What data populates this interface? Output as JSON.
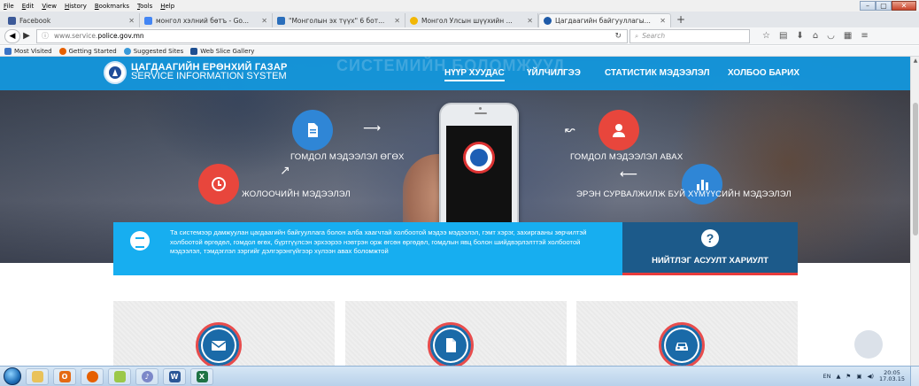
{
  "browser": {
    "menu": [
      "File",
      "Edit",
      "View",
      "History",
      "Bookmarks",
      "Tools",
      "Help"
    ],
    "tabs": [
      {
        "title": "Facebook",
        "color": "#3b5998"
      },
      {
        "title": "монгол хэлний бөтъ - Go...",
        "color": "#4285f4"
      },
      {
        "title": "\"Монголын эх түүх\" 6 бот...",
        "color": "#2a6ebb"
      },
      {
        "title": "Монгол Улсын шүүхийн ...",
        "color": "#f2b705"
      },
      {
        "title": "Цагдаагийн байгууллагы...",
        "color": "#1e5aa8"
      }
    ],
    "url_prefix": "www.service.",
    "url_host": "police.gov.mn",
    "search_placeholder": "Search",
    "bookmarks": [
      "Most Visited",
      "Getting Started",
      "Suggested Sites",
      "Web Slice Gallery"
    ]
  },
  "site": {
    "title": "ЦАГДААГИЙН ЕРӨНХИЙ ГАЗАР",
    "subtitle": "SERVICE INFORMATION SYSTEM",
    "ghost_text": "СИСТЕМИЙН БОЛОМЖУУД",
    "nav": [
      "НҮҮР ХУУДАС",
      "ҮЙЛЧИЛГЭЭ",
      "СТАТИСТИК МЭДЭЭЛЭЛ",
      "ХОЛБОО БАРИХ"
    ]
  },
  "features": [
    {
      "label": "ГОМДОЛ МЭДЭЭЛЭЛ ӨГӨХ",
      "color": "#2f86d6",
      "icon": "document-icon"
    },
    {
      "label": "ГОМДОЛ МЭДЭЭЛЭЛ АВАХ",
      "color": "#e8463c",
      "icon": "user-icon"
    },
    {
      "label": "ЖОЛООЧИЙН МЭДЭЭЛЭЛ",
      "color": "#e8463c",
      "icon": "clock-icon"
    },
    {
      "label": "ЭРЭН СУРВАЛЖИЛЖ БУЙ ХҮМҮҮСИЙН МЭДЭЭЛЭЛ",
      "color": "#2f86d6",
      "icon": "bar-chart-icon"
    }
  ],
  "info": {
    "text": "Та системээр дамжуулан цагдаагийн байгууллага болон алба хаагчтай холбоотой мэдээ мэдээлэл, гэмт хэрэг, захиргааны зөрчилтэй холбоотой өргөдөл, гомдол өгөх, бүртгүүлсэн эрхээрээ нэвтрэн орж өгсөн өргөдөл, гомдлын явц болон шийдвэрлэлттэй холбоотой мэдээлэл, тэмдэглэл зэргийг дэлгэрэнгүйгээр хүлээн авах боломжтой",
    "faq_label": "НИЙТЛЭГ АСУУЛТ ХАРИУЛТ"
  },
  "cards": [
    {
      "icon": "envelope-icon"
    },
    {
      "icon": "file-icon"
    },
    {
      "icon": "car-icon"
    }
  ],
  "taskbar": {
    "lang": "EN",
    "time": "20:05",
    "date": "17.03.15"
  },
  "colors": {
    "site_blue": "#1496dc",
    "info_blue": "#17aef0",
    "faq_navy": "#1c5a8a",
    "accent_red": "#e8463c"
  }
}
